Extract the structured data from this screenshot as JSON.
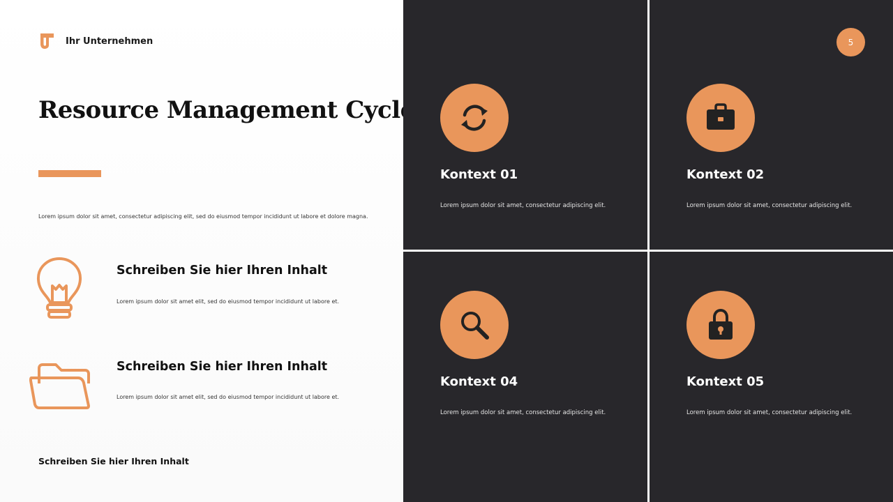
{
  "brand": {
    "name": "Ihr Unternehmen",
    "logo": "brand-logo-icon"
  },
  "title": "Resource Management Cycle",
  "intro": "Lorem ipsum dolor sit amet, consectetur adipiscing elit, sed do eiusmod tempor incididunt ut labore et dolore magna.",
  "features": [
    {
      "icon": "lightbulb-icon",
      "title": "Schreiben Sie hier Ihren Inhalt",
      "desc": "Lorem ipsum dolor sit amet elit, sed do eiusmod tempor incididunt ut labore et."
    },
    {
      "icon": "folder-icon",
      "title": "Schreiben Sie hier Ihren Inhalt",
      "desc": "Lorem ipsum dolor sit amet elit, sed do eiusmod tempor incididunt ut labore et."
    }
  ],
  "footer": "Schreiben Sie hier Ihren Inhalt",
  "page_number": "5",
  "tiles": [
    {
      "icon": "refresh-cycle-icon",
      "title": "Kontext 01",
      "desc": "Lorem ipsum dolor sit amet, consectetur adipiscing elit."
    },
    {
      "icon": "briefcase-icon",
      "title": "Kontext 02",
      "desc": "Lorem ipsum dolor sit amet, consectetur adipiscing elit."
    },
    {
      "icon": "search-icon",
      "title": "Kontext 04",
      "desc": "Lorem ipsum dolor sit amet, consectetur adipiscing elit."
    },
    {
      "icon": "lock-icon",
      "title": "Kontext 05",
      "desc": "Lorem ipsum dolor sit amet, consectetur adipiscing elit."
    }
  ],
  "colors": {
    "accent": "#e9965b",
    "dark_tile": "#28272b",
    "text": "#111111"
  }
}
